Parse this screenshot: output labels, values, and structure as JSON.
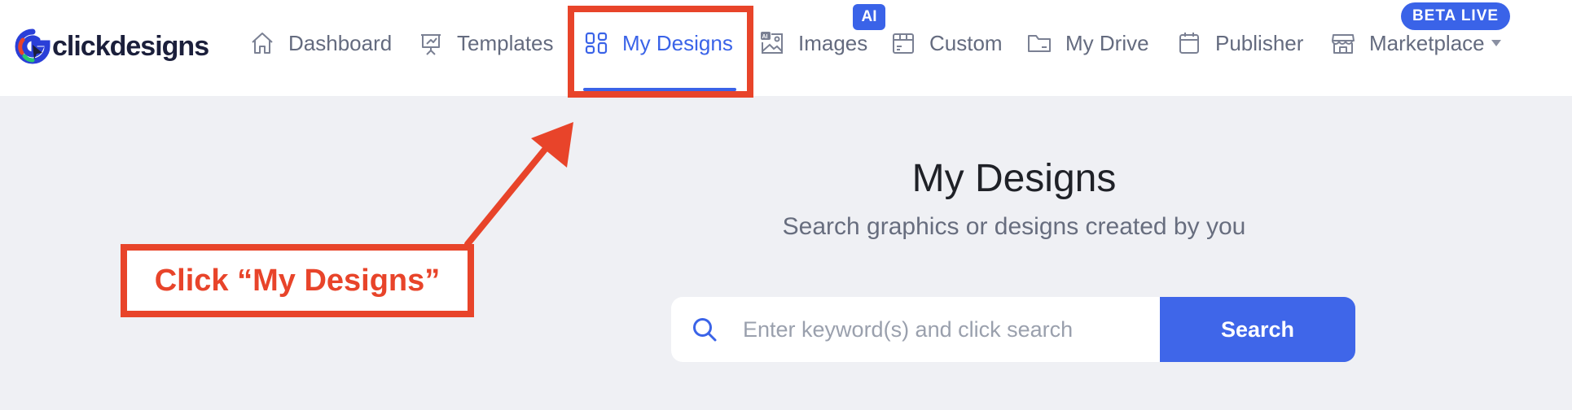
{
  "brand": {
    "name": "clickdesigns"
  },
  "nav": {
    "items": [
      {
        "label": "Dashboard",
        "icon": "home-icon"
      },
      {
        "label": "Templates",
        "icon": "presentation-icon"
      },
      {
        "label": "My Designs",
        "icon": "grid-icon",
        "active": true
      },
      {
        "label": "Images",
        "icon": "ai-image-icon",
        "badge": "AI"
      },
      {
        "label": "Custom",
        "icon": "box-icon"
      },
      {
        "label": "My Drive",
        "icon": "folder-icon"
      },
      {
        "label": "Publisher",
        "icon": "calendar-icon"
      },
      {
        "label": "Marketplace",
        "icon": "store-icon",
        "badge": "BETA LIVE",
        "dropdown": true
      }
    ]
  },
  "annotation": {
    "callout": "Click “My Designs”"
  },
  "main": {
    "title": "My Designs",
    "subtitle": "Search graphics or designs created by you",
    "search": {
      "placeholder": "Enter keyword(s) and click search",
      "button": "Search"
    }
  },
  "colors": {
    "accent": "#3a63e8",
    "annotation": "#e8442a",
    "background": "#eff0f4",
    "nav_text": "#646b7f"
  }
}
